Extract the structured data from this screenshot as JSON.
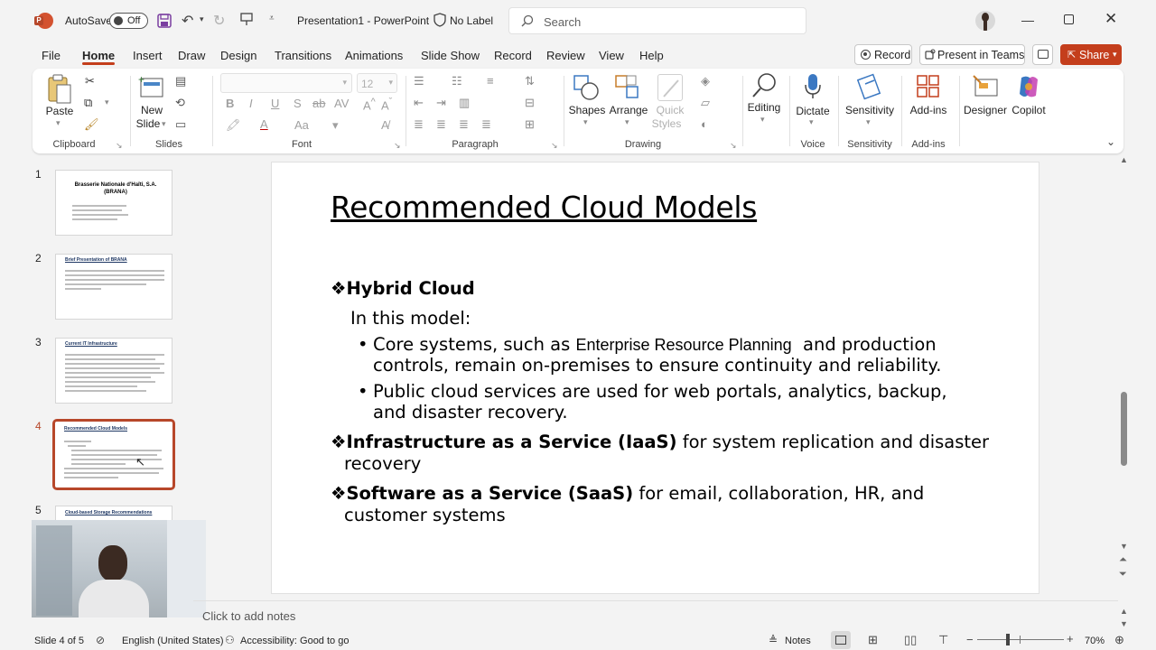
{
  "titlebar": {
    "autosave_label": "AutoSave",
    "autosave_state": "Off",
    "doc_title": "Presentation1 - PowerPoint",
    "label_status": "No Label",
    "search_placeholder": "Search"
  },
  "tabs": [
    "File",
    "Home",
    "Insert",
    "Draw",
    "Design",
    "Transitions",
    "Animations",
    "Slide Show",
    "Record",
    "Review",
    "View",
    "Help"
  ],
  "active_tab": "Home",
  "top_buttons": {
    "record": "Record",
    "present": "Present in Teams",
    "share": "Share"
  },
  "ribbon": {
    "clipboard": {
      "paste": "Paste",
      "group": "Clipboard"
    },
    "slides": {
      "new_slide_line1": "New",
      "new_slide_line2": "Slide",
      "group": "Slides"
    },
    "font": {
      "size": "12",
      "group": "Font",
      "bold": "B",
      "italic": "I",
      "underline": "U",
      "shadow": "S",
      "strike": "ab",
      "change_case": "Aa"
    },
    "paragraph": {
      "group": "Paragraph"
    },
    "drawing": {
      "shapes": "Shapes",
      "arrange": "Arrange",
      "quick_styles_1": "Quick",
      "quick_styles_2": "Styles",
      "group": "Drawing"
    },
    "editing": {
      "label": "Editing"
    },
    "voice": {
      "dictate": "Dictate",
      "group": "Voice"
    },
    "sensitivity": {
      "label": "Sensitivity",
      "group": "Sensitivity"
    },
    "addins": {
      "label": "Add-ins",
      "group": "Add-ins"
    },
    "designer": {
      "label": "Designer"
    },
    "copilot": {
      "label": "Copilot"
    }
  },
  "thumbnails": [
    {
      "num": "1",
      "title": "Brasserie Nationale d'Haïti, S.A. (BRANA)"
    },
    {
      "num": "2",
      "title": "Brief Presentation of BRANA"
    },
    {
      "num": "3",
      "title": "Current IT Infrastructure"
    },
    {
      "num": "4",
      "title": "Recommended Cloud Models"
    },
    {
      "num": "5",
      "title": "Cloud-based Storage Recommendations"
    }
  ],
  "slide": {
    "title": "Recommended Cloud Models",
    "hybrid_heading": "Hybrid Cloud",
    "in_this_model": "In this model:",
    "bullet1_a": "Core systems, such as",
    "bullet1_erp": "Enterprise Resource Planning",
    "bullet1_b": "and production",
    "bullet1_line2": "controls, remain on-premises to ensure continuity and reliability.",
    "bullet2_line1": "Public cloud services are used for web portals, analytics, backup,",
    "bullet2_line2": "and disaster recovery.",
    "iaas_bold": "Infrastructure as a Service (IaaS)",
    "iaas_rest": "for system replication and disaster",
    "iaas_line2": "recovery",
    "saas_bold": "Software as a Service (SaaS)",
    "saas_rest": "for email, collaboration, HR, and",
    "saas_line2": "customer systems"
  },
  "notes_placeholder": "Click to add notes",
  "status": {
    "slide_counter": "Slide 4 of 5",
    "language": "English (United States)",
    "accessibility": "Accessibility: Good to go",
    "notes": "Notes",
    "zoom": "70%"
  },
  "colors": {
    "accent": "#c43e1c",
    "share_bg": "#c43e1c",
    "selected_thumb": "#b7472a"
  }
}
